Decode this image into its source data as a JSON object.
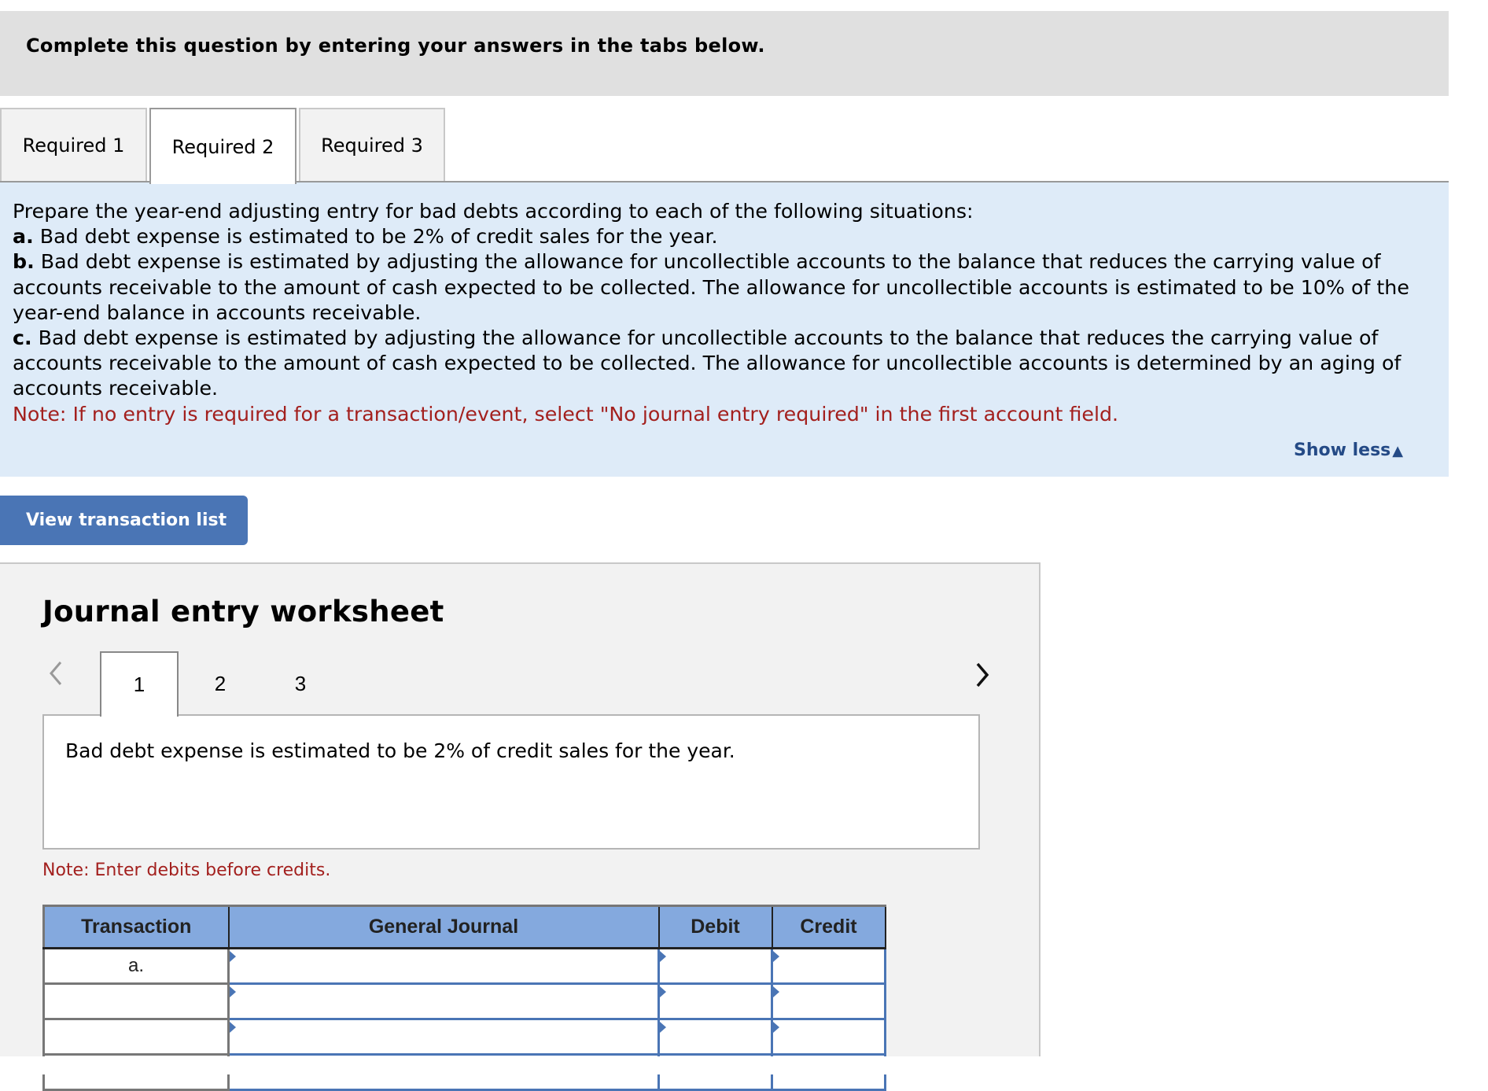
{
  "header": {
    "instruction": "Complete this question by entering your answers in the tabs below."
  },
  "tabs": [
    {
      "label": "Required 1",
      "active": false
    },
    {
      "label": "Required 2",
      "active": true
    },
    {
      "label": "Required 3",
      "active": false
    }
  ],
  "panel": {
    "intro": "Prepare the year-end adjusting entry for bad debts according to each of the following situations:",
    "items": [
      {
        "key": "a.",
        "text": " Bad debt expense is estimated to be 2% of credit sales for the year."
      },
      {
        "key": "b.",
        "text": " Bad debt expense is estimated by adjusting the allowance for uncollectible accounts to the balance that reduces the carrying value of accounts receivable to the amount of cash expected to be collected. The allowance for uncollectible accounts is estimated to be 10% of the year-end balance in accounts receivable."
      },
      {
        "key": "c.",
        "text": " Bad debt expense is estimated by adjusting the allowance for uncollectible accounts to the balance that reduces the carrying value of accounts receivable to the amount of cash expected to be collected. The allowance for uncollectible accounts is determined by an aging of accounts receivable."
      }
    ],
    "note": "Note: If no entry is required for a transaction/event, select \"No journal entry required\" in the first account field.",
    "show_less": "Show less",
    "show_less_icon": "triangle-up-icon"
  },
  "view_transaction_list": "View transaction list",
  "worksheet": {
    "title": "Journal entry worksheet",
    "prev_icon": "chevron-left-icon",
    "next_icon": "chevron-right-icon",
    "pages": [
      "1",
      "2",
      "3"
    ],
    "active_page": "1",
    "description": "Bad debt expense is estimated to be 2% of credit sales for the year.",
    "note": "Note: Enter debits before credits."
  },
  "journal_table": {
    "headers": [
      "Transaction",
      "General Journal",
      "Debit",
      "Credit"
    ],
    "rows": [
      {
        "transaction": "a.",
        "account": "",
        "debit": "",
        "credit": ""
      },
      {
        "transaction": "",
        "account": "",
        "debit": "",
        "credit": ""
      },
      {
        "transaction": "",
        "account": "",
        "debit": "",
        "credit": ""
      }
    ]
  },
  "colors": {
    "accent_blue": "#4a75b5",
    "table_header": "#84a9de",
    "note_red": "#a3201e",
    "panel_bg": "#deebf8",
    "link": "#244a86"
  }
}
